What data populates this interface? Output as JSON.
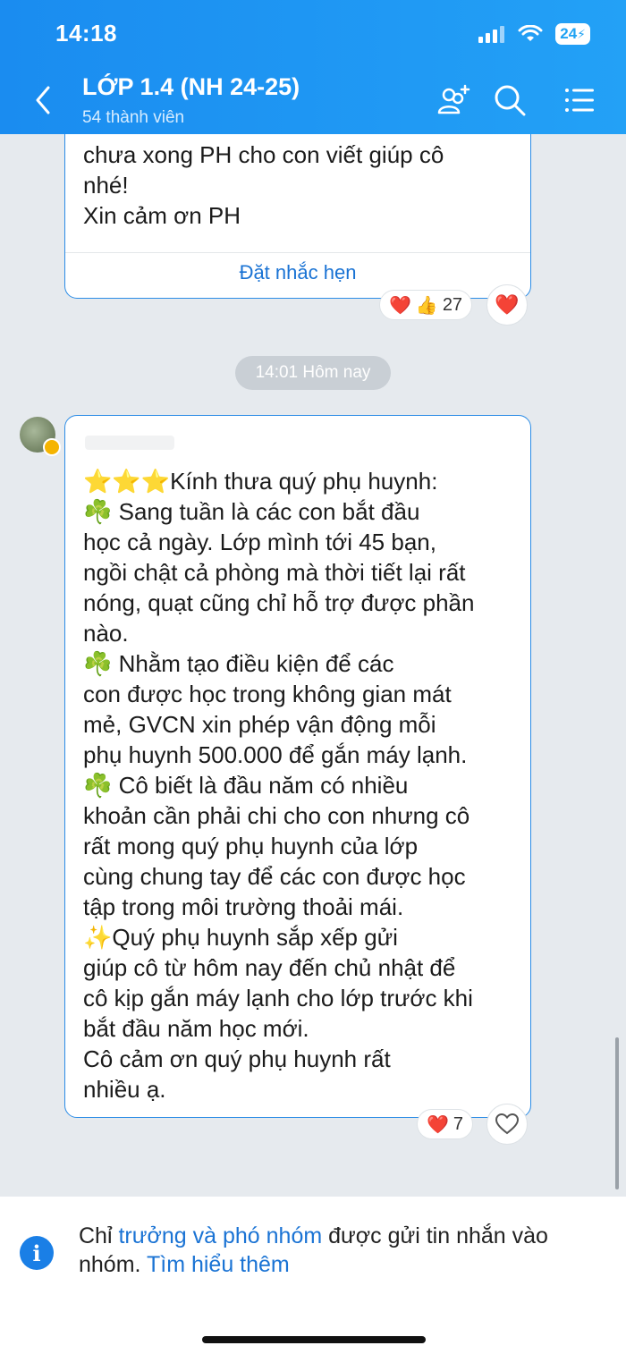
{
  "status_bar": {
    "time": "14:18",
    "battery": "24"
  },
  "header": {
    "title": "LỚP 1.4 (NH 24-25)",
    "subtitle": "54 thành viên",
    "icons": [
      "back-icon",
      "add-member-icon",
      "search-icon",
      "menu-icon"
    ]
  },
  "messages": [
    {
      "text": "chưa xong PH cho con viết giúp cô\nnhé!\nXin cảm ơn PH",
      "action_label": "Đặt nhắc hẹn",
      "reaction_icons": [
        "❤️",
        "👍"
      ],
      "reaction_count": "27",
      "my_reaction": "❤️"
    },
    {
      "text": "⭐⭐⭐Kính thưa quý phụ huynh:\n     ☘️ Sang tuần là các con bắt đầu\nhọc cả ngày. Lớp mình tới 45 bạn,\nngồi chật cả phòng mà thời tiết lại rất\nnóng, quạt cũng chỉ hỗ trợ được phần\nnào.\n     ☘️ Nhằm tạo điều kiện để các\ncon được học trong không gian mát\nmẻ, GVCN xin phép vận động mỗi\nphụ huynh 500.000 để gắn máy lạnh.\n     ☘️ Cô biết là đầu năm có nhiều\nkhoản cần phải chi cho con nhưng cô\nrất mong quý phụ huynh của lớp\ncùng chung tay để các con được học\ntập trong môi trường thoải mái.\n     ✨Quý phụ huynh sắp xếp gửi\ngiúp cô từ hôm nay đến chủ nhật để\ncô kịp gắn máy lạnh cho lớp trước khi\nbắt đầu năm học mới.\n   Cô cảm ơn quý phụ huynh rất\nnhiều ạ.",
      "reaction_icons": [
        "❤️"
      ],
      "reaction_count": "7"
    }
  ],
  "time_separator": "14:01 Hôm nay",
  "footer": {
    "text_before": "Chỉ ",
    "link1": "trưởng và phó nhóm",
    "text_middle": " được gửi tin nhắn vào nhóm. ",
    "link2": "Tìm hiểu thêm"
  },
  "colors": {
    "accent": "#1a8cf0",
    "link": "#1a73d4",
    "heart": "#e0203a"
  }
}
